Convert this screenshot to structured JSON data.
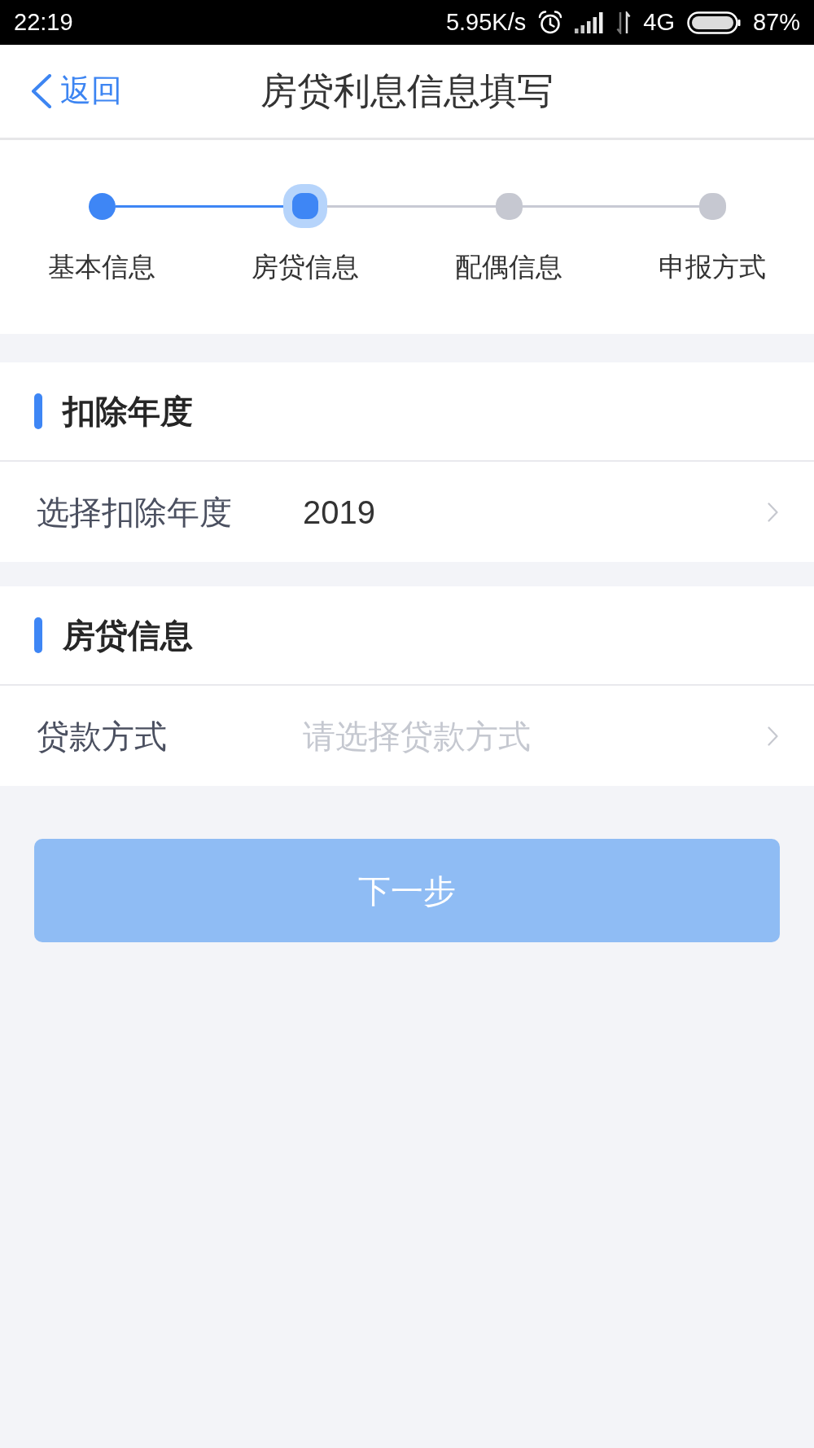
{
  "status_bar": {
    "time": "22:19",
    "speed": "5.95K/s",
    "network": "4G",
    "battery": "87%"
  },
  "header": {
    "back": "返回",
    "title": "房贷利息信息填写"
  },
  "steps": [
    {
      "label": "基本信息",
      "done": true,
      "selected": false
    },
    {
      "label": "房贷信息",
      "done": false,
      "selected": true
    },
    {
      "label": "配偶信息",
      "done": false,
      "selected": false
    },
    {
      "label": "申报方式",
      "done": false,
      "selected": false
    }
  ],
  "sections": [
    {
      "title": "扣除年度",
      "rows": [
        {
          "label": "选择扣除年度",
          "value": "2019"
        }
      ]
    },
    {
      "title": "房贷信息",
      "rows": [
        {
          "label": "贷款方式",
          "placeholder": "请选择贷款方式"
        }
      ]
    }
  ],
  "next_button": {
    "label": "下一步",
    "disabled": true
  }
}
